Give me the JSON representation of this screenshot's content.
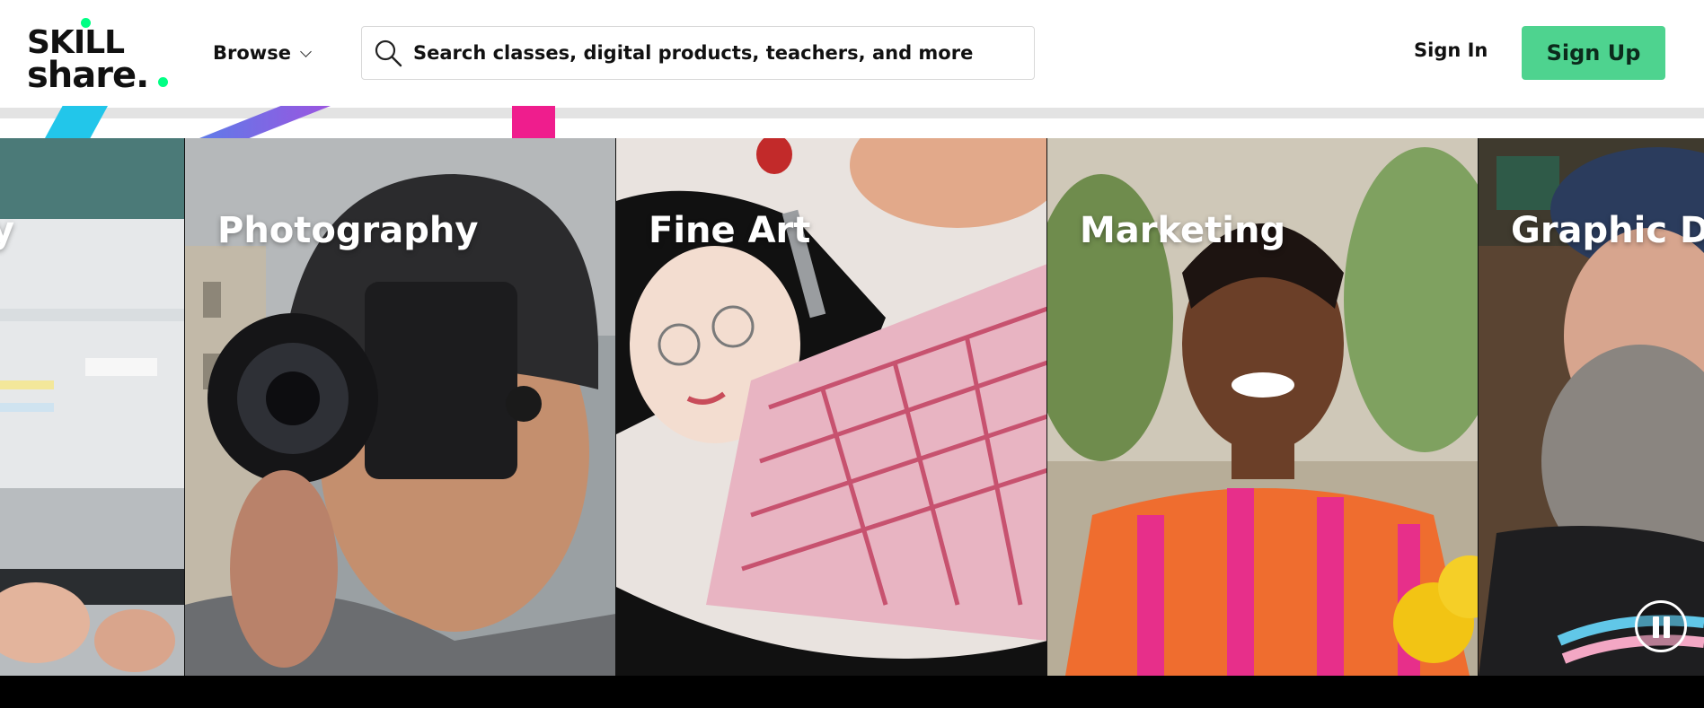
{
  "header": {
    "logo": {
      "line1": "SKILL",
      "line2": "share."
    },
    "browse_label": "Browse",
    "search_placeholder": "Search classes, digital products, teachers, and more",
    "sign_in_label": "Sign In",
    "sign_up_label": "Sign Up"
  },
  "colors": {
    "sign_up_bg": "#4ed38f",
    "logo_dot": "#00ff84",
    "strip_cyan": "#22c6ea",
    "strip_purple": "#7d6ae6",
    "strip_pink": "#ef1d8d"
  },
  "carousel": {
    "tiles": [
      {
        "label": "Productivity",
        "visible_text": "y",
        "icon": "laptop-notion-image"
      },
      {
        "label": "Photography",
        "icon": "photographer-image"
      },
      {
        "label": "Fine Art",
        "icon": "painting-image"
      },
      {
        "label": "Marketing",
        "icon": "smiling-woman-image"
      },
      {
        "label": "Graphic De",
        "icon": "bearded-man-image"
      }
    ],
    "pause_icon": "pause-icon"
  }
}
